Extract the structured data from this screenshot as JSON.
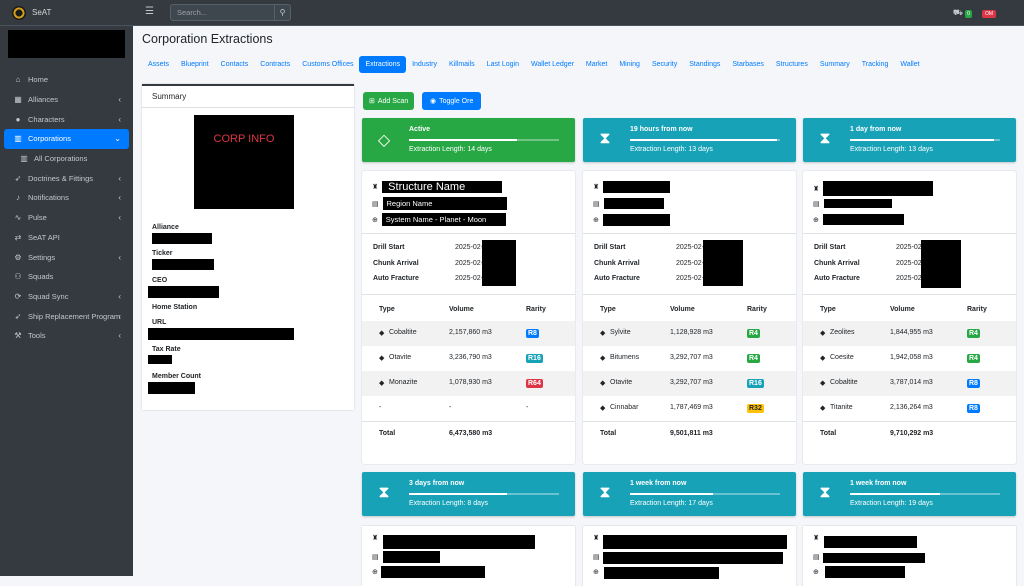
{
  "brand": {
    "name": "SeAT"
  },
  "topbar": {
    "search_placeholder": "Search...",
    "badge_green": "0",
    "badge_red": "OM"
  },
  "sidebar": {
    "items": [
      {
        "label": "Home",
        "icon": "home-icon"
      },
      {
        "label": "Alliances",
        "icon": "alliance-icon"
      },
      {
        "label": "Characters",
        "icon": "user-icon"
      },
      {
        "label": "Corporations",
        "icon": "building-icon"
      },
      {
        "label": "All Corporations",
        "icon": "building-icon"
      },
      {
        "label": "Doctrines & Fittings",
        "icon": "rocket-icon"
      },
      {
        "label": "Notifications",
        "icon": "bell-icon"
      },
      {
        "label": "Pulse",
        "icon": "wave-icon"
      },
      {
        "label": "SeAT API",
        "icon": "exchange-icon"
      },
      {
        "label": "Settings",
        "icon": "gear-icon"
      },
      {
        "label": "Squads",
        "icon": "users-icon"
      },
      {
        "label": "Squad Sync",
        "icon": "sync-icon"
      },
      {
        "label": "Ship Replacement Program",
        "icon": "rocket-icon"
      },
      {
        "label": "Tools",
        "icon": "wrench-icon"
      }
    ]
  },
  "page": {
    "title": "Corporation Extractions"
  },
  "tabs": [
    "Assets",
    "Blueprint",
    "Contacts",
    "Contracts",
    "Customs Offices",
    "Extractions",
    "Industry",
    "Killmails",
    "Last Login",
    "Wallet Ledger",
    "Market",
    "Mining",
    "Security",
    "Standings",
    "Starbases",
    "Structures",
    "Summary",
    "Tracking",
    "Wallet"
  ],
  "summary": {
    "title": "Summary",
    "image_text": "CORP INFO",
    "labels": {
      "alliance": "Alliance",
      "ticker": "Ticker",
      "ceo": "CEO",
      "home": "Home Station",
      "url": "URL",
      "tax": "Tax Rate",
      "members": "Member Count"
    }
  },
  "buttons": {
    "add_scan": "Add Scan",
    "toggle_ore": "Toggle Ore"
  },
  "boxes": [
    {
      "title": "Active",
      "sub": "Extraction Length: 14 days",
      "progress": 0.72
    },
    {
      "title": "19 hours from now",
      "sub": "Extraction Length: 13 days",
      "progress": 0.98
    },
    {
      "title": "1 day from now",
      "sub": "Extraction Length: 13 days",
      "progress": 0.96
    },
    {
      "title": "3 days from now",
      "sub": "Extraction Length: 8 days",
      "progress": 0.65
    },
    {
      "title": "1 week from now",
      "sub": "Extraction Length: 17 days",
      "progress": 0.55
    },
    {
      "title": "1 week from now",
      "sub": "Extraction Length: 19 days",
      "progress": 0.6
    }
  ],
  "card_labels": {
    "drill_start": "Drill Start",
    "chunk_arrival": "Chunk Arrival",
    "auto_fracture": "Auto Fracture",
    "type": "Type",
    "volume": "Volume",
    "rarity": "Rarity",
    "total": "Total"
  },
  "cards": [
    {
      "structure": "Structure Name",
      "region": "Region Name",
      "system": "System Name - Planet - Moon",
      "date_prefix": "2025-02-",
      "ores": [
        {
          "type": "Cobaltite",
          "volume": "2,157,860 m3",
          "rarity": "R8"
        },
        {
          "type": "Otavite",
          "volume": "3,236,790 m3",
          "rarity": "R16"
        },
        {
          "type": "Monazite",
          "volume": "1,078,930 m3",
          "rarity": "R64"
        },
        {
          "type": "-",
          "volume": "-",
          "rarity": "-"
        }
      ],
      "total": "6,473,580 m3"
    },
    {
      "structure": "",
      "region": "",
      "system": "",
      "date_prefix": "2025-02-",
      "ores": [
        {
          "type": "Sylvite",
          "volume": "1,128,928 m3",
          "rarity": "R4"
        },
        {
          "type": "Bitumens",
          "volume": "3,292,707 m3",
          "rarity": "R4"
        },
        {
          "type": "Otavite",
          "volume": "3,292,707 m3",
          "rarity": "R16"
        },
        {
          "type": "Cinnabar",
          "volume": "1,787,469 m3",
          "rarity": "R32"
        }
      ],
      "total": "9,501,811 m3"
    },
    {
      "structure": "",
      "region": "",
      "system": "",
      "date_prefix": "2025-02",
      "ores": [
        {
          "type": "Zeolites",
          "volume": "1,844,955 m3",
          "rarity": "R4"
        },
        {
          "type": "Coesite",
          "volume": "1,942,058 m3",
          "rarity": "R4"
        },
        {
          "type": "Cobaltite",
          "volume": "3,787,014 m3",
          "rarity": "R8"
        },
        {
          "type": "Titanite",
          "volume": "2,136,264 m3",
          "rarity": "R8"
        }
      ],
      "total": "9,710,292 m3"
    }
  ]
}
